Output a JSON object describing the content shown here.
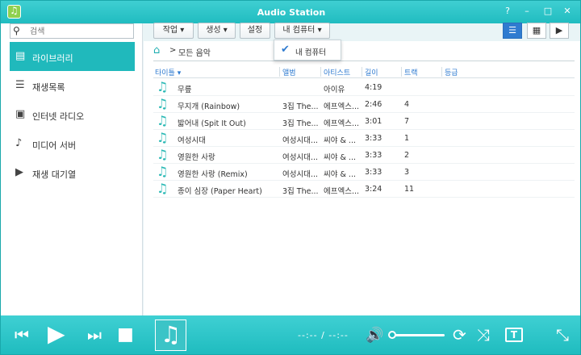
{
  "window": {
    "title": "Audio Station",
    "controls": [
      "?",
      "–",
      "□",
      "✕"
    ]
  },
  "search": {
    "placeholder": "검색"
  },
  "sidebar": {
    "items": [
      {
        "label": "라이브러리",
        "icon": "library-icon",
        "active": true
      },
      {
        "label": "재생목록",
        "icon": "playlist-icon",
        "active": false
      },
      {
        "label": "인터넷 라디오",
        "icon": "radio-icon",
        "active": false
      },
      {
        "label": "미디어 서버",
        "icon": "media-server-icon",
        "active": false
      },
      {
        "label": "재생 대기열",
        "icon": "play-queue-icon",
        "active": false
      }
    ]
  },
  "toolbar": {
    "action": "작업",
    "create": "생성",
    "settings": "설정",
    "player_select": "내 컴퓨터"
  },
  "dropdown": {
    "item": "내 컴퓨터"
  },
  "breadcrumb": {
    "separator": ">",
    "current": "모든 음악"
  },
  "table": {
    "headers": [
      "타이틀",
      "앨범",
      "아티스트",
      "길이",
      "트랙",
      "등급"
    ],
    "rows": [
      {
        "title": "무릎",
        "album": "",
        "artist": "아이유",
        "length": "4:19",
        "track": ""
      },
      {
        "title": "무지개 (Rainbow)",
        "album": "3집 The...",
        "artist": "에프엑스...",
        "length": "2:46",
        "track": "4"
      },
      {
        "title": "밟어내 (Spit It Out)",
        "album": "3집 The...",
        "artist": "에프엑스...",
        "length": "3:01",
        "track": "7"
      },
      {
        "title": "여성시대",
        "album": "여성시대...",
        "artist": "씨야 & ...",
        "length": "3:33",
        "track": "1"
      },
      {
        "title": "영원한 사랑",
        "album": "여성시대...",
        "artist": "씨야 & ...",
        "length": "3:33",
        "track": "2"
      },
      {
        "title": "영원한 사랑 (Remix)",
        "album": "여성시대...",
        "artist": "씨야 & ...",
        "length": "3:33",
        "track": "3"
      },
      {
        "title": "종이 심장 (Paper Heart)",
        "album": "3집 The...",
        "artist": "에프엑스...",
        "length": "3:24",
        "track": "11"
      }
    ]
  },
  "player": {
    "time": "--:-- / --:--",
    "volume": 0.0
  }
}
